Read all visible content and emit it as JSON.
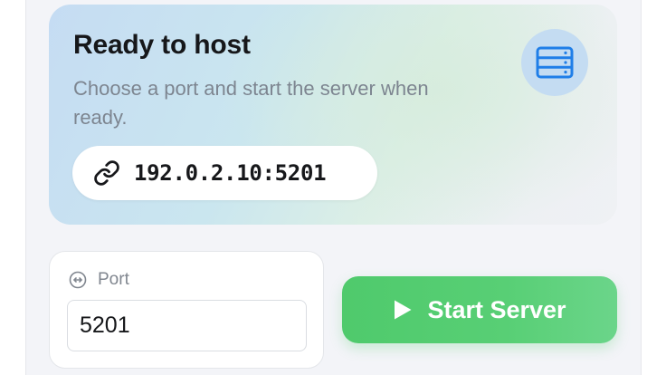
{
  "hero": {
    "title": "Ready to host",
    "subtitle": "Choose a port and start the server when ready.",
    "icon": "server-icon",
    "address": "192.0.2.10:5201",
    "address_icon": "link-icon"
  },
  "port": {
    "label": "Port",
    "icon": "arrows-horizontal-icon",
    "value": "5201"
  },
  "start_button": {
    "label": "Start Server",
    "icon": "play-icon"
  },
  "colors": {
    "accent_green": "#4fca6c",
    "accent_blue": "#1f7ee8",
    "title_text": "#16171a",
    "muted_text": "#7d8590"
  }
}
